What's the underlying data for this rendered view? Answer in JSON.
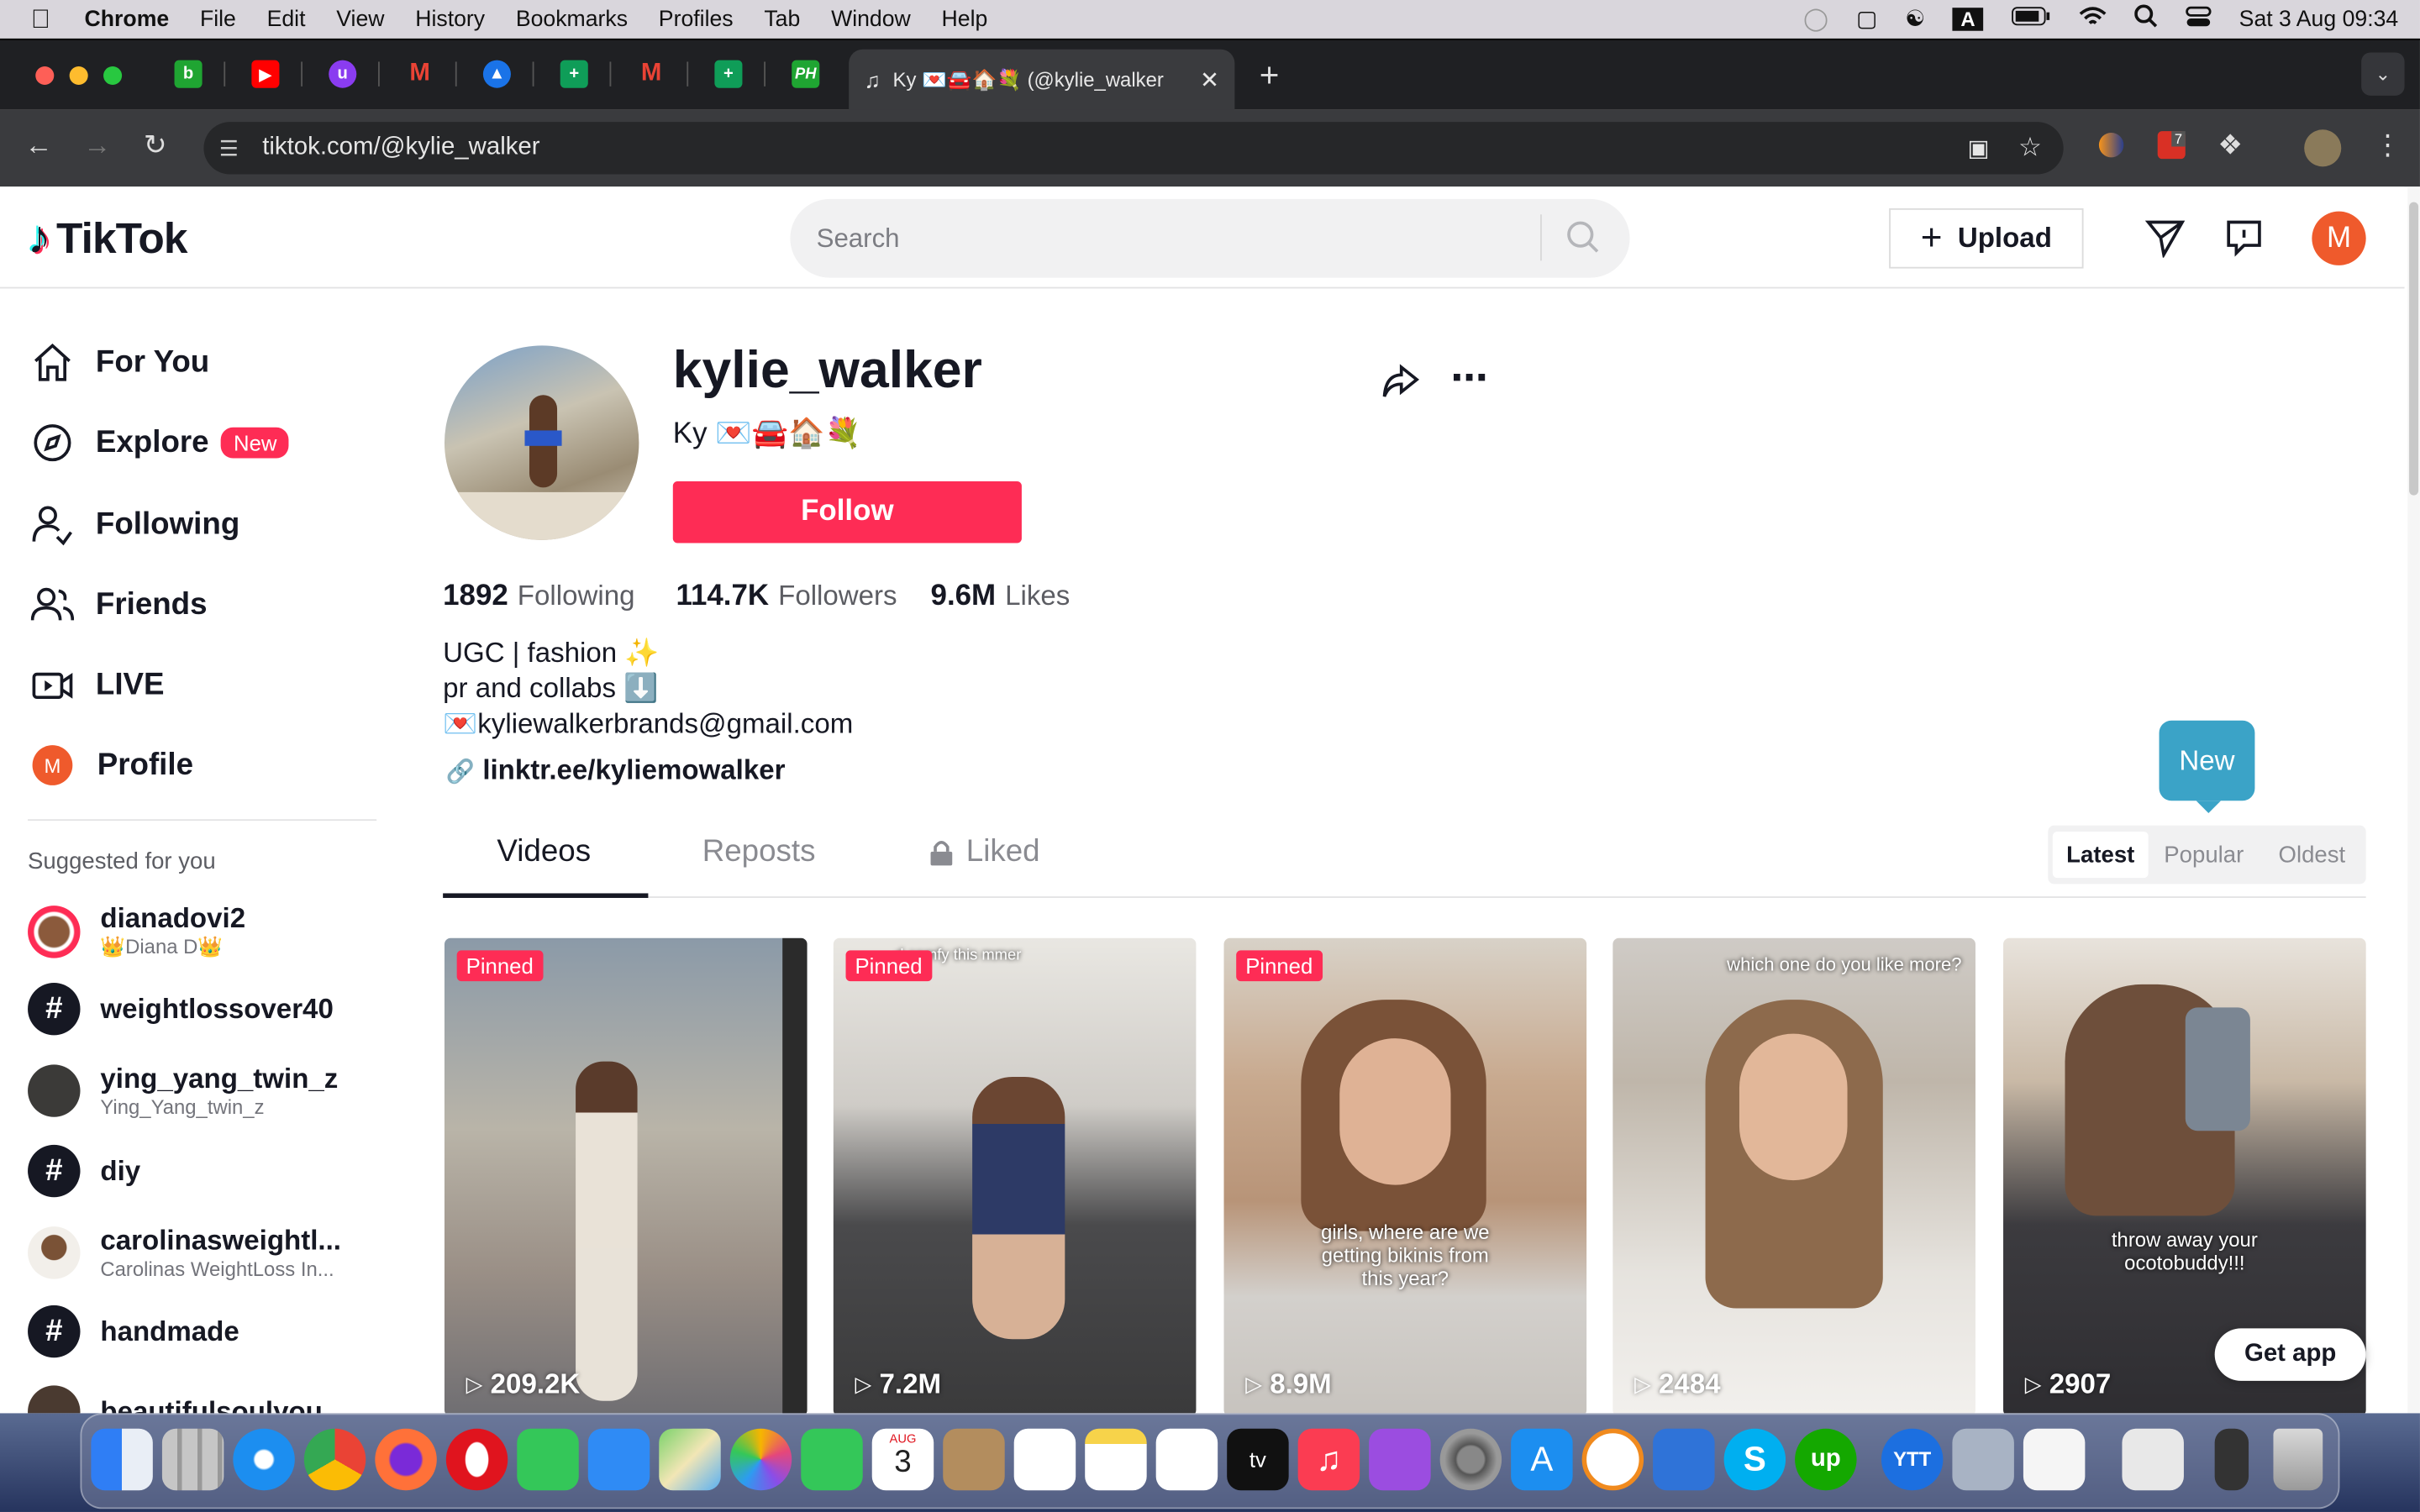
{
  "menubar": {
    "apple": "",
    "items": [
      "Chrome",
      "File",
      "Edit",
      "View",
      "History",
      "Bookmarks",
      "Profiles",
      "Tab",
      "Window",
      "Help"
    ],
    "datetime": "Sat 3 Aug  09:34",
    "input_badge": "A"
  },
  "browser": {
    "active_tab_title": "Ky 💌🚘🏠💐 (@kylie_walker",
    "url": "tiktok.com/@kylie_walker",
    "ext_badge": "7"
  },
  "tiktok": {
    "logo": "TikTok",
    "search_placeholder": "Search",
    "upload": "Upload",
    "avatar_letter": "M",
    "nav": [
      {
        "label": "For You"
      },
      {
        "label": "Explore",
        "badge": "New"
      },
      {
        "label": "Following"
      },
      {
        "label": "Friends"
      },
      {
        "label": "LIVE"
      },
      {
        "label": "Profile"
      }
    ],
    "suggested_title": "Suggested for you",
    "suggested": [
      {
        "name": "dianadovi2",
        "sub": "👑Diana D👑"
      },
      {
        "name": "weightlossover40",
        "sub": ""
      },
      {
        "name": "ying_yang_twin_z",
        "sub": "Ying_Yang_twin_z"
      },
      {
        "name": "diy",
        "sub": ""
      },
      {
        "name": "carolinasweightl...",
        "sub": "Carolinas WeightLoss In..."
      },
      {
        "name": "handmade",
        "sub": ""
      },
      {
        "name": "beautifulsoulyou...",
        "sub": ""
      }
    ],
    "hashtag_symbol": "#"
  },
  "profile": {
    "username": "kylie_walker",
    "nickname": "Ky 💌🚘🏠💐",
    "follow": "Follow",
    "stats": [
      {
        "value": "1892",
        "label": "Following"
      },
      {
        "value": "114.7K",
        "label": "Followers"
      },
      {
        "value": "9.6M",
        "label": "Likes"
      }
    ],
    "bio": [
      "UGC | fashion ✨",
      "pr and collabs ⬇️",
      "💌kyliewalkerbrands@gmail.com"
    ],
    "link": "linktr.ee/kyliemowalker",
    "tabs": [
      "Videos",
      "Reposts",
      "Liked"
    ],
    "sort": [
      "Latest",
      "Popular",
      "Oldest"
    ],
    "tooltip": "New",
    "videos": [
      {
        "pinned": "Pinned",
        "views": "209.2K",
        "caption": ""
      },
      {
        "pinned": "Pinned",
        "views": "7.2M",
        "caption": "d comfy this mmer"
      },
      {
        "pinned": "Pinned",
        "views": "8.9M",
        "caption": "girls, where are we getting bikinis from this year?"
      },
      {
        "pinned": "",
        "views": "2484",
        "caption": "which one do you like more?"
      },
      {
        "pinned": "",
        "views": "2907",
        "caption": "throw away your ocotobuddy!!!"
      }
    ],
    "get_app": "Get app"
  },
  "dock": {
    "calendar_month": "AUG",
    "calendar_day": "3",
    "tv_label": "tv"
  }
}
